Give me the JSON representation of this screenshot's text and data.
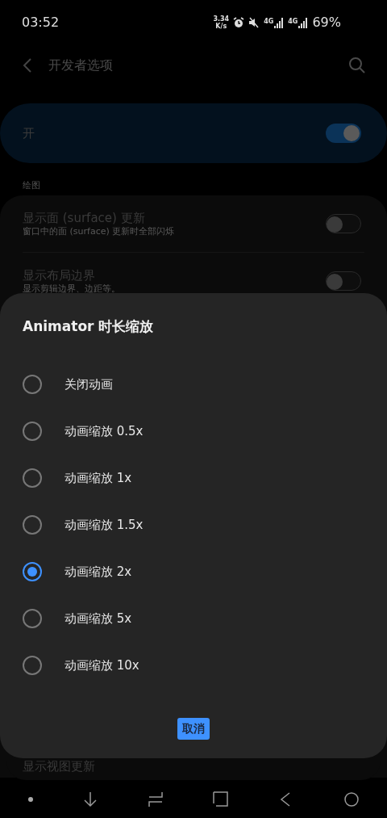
{
  "status_bar": {
    "time": "03:52",
    "net_speed": [
      "3.34",
      "K/s"
    ],
    "networks": [
      "4G",
      "4G"
    ],
    "battery": "69%"
  },
  "header": {
    "title": "开发者选项"
  },
  "master_switch": {
    "label": "开",
    "on": true
  },
  "section": {
    "title": "绘图"
  },
  "settings": [
    {
      "title": "显示面 (surface) 更新",
      "subtitle": "窗口中的面 (surface) 更新时全部闪烁",
      "on": false
    },
    {
      "title": "显示布局边界",
      "subtitle": "显示剪辑边界、边距等。",
      "on": false
    }
  ],
  "dialog": {
    "title": "Animator 时长缩放",
    "options": [
      {
        "label": "关闭动画",
        "selected": false
      },
      {
        "label": "动画缩放 0.5x",
        "selected": false
      },
      {
        "label": "动画缩放 1x",
        "selected": false
      },
      {
        "label": "动画缩放 1.5x",
        "selected": false
      },
      {
        "label": "动画缩放 2x",
        "selected": true
      },
      {
        "label": "动画缩放 5x",
        "selected": false
      },
      {
        "label": "动画缩放 10x",
        "selected": false
      }
    ],
    "cancel": "取消"
  },
  "below_dialog": {
    "title": "显示视图更新"
  }
}
